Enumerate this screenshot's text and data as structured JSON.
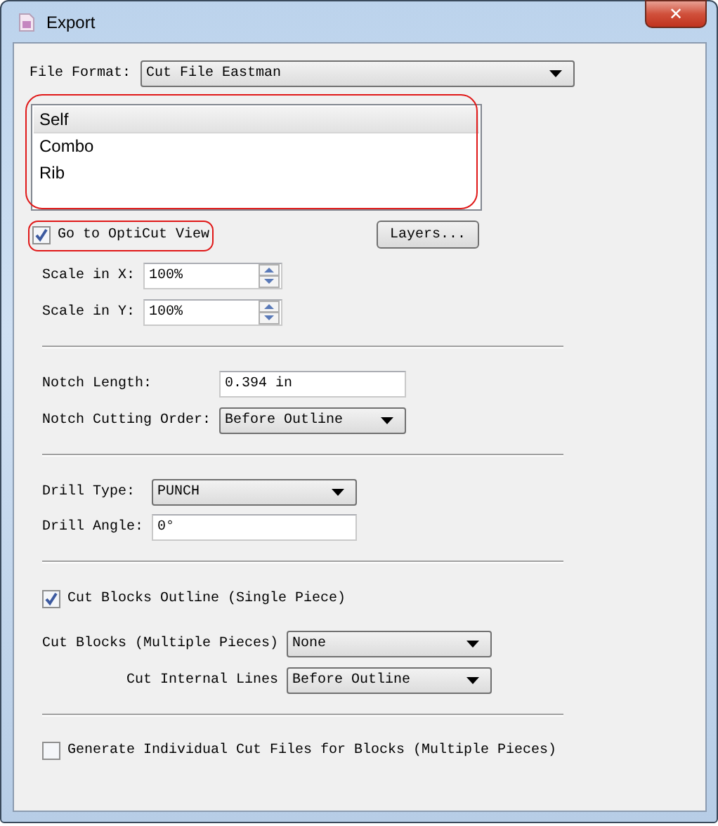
{
  "window": {
    "title": "Export",
    "close": "✕"
  },
  "file_format": {
    "label": "File Format:",
    "value": "Cut File Eastman"
  },
  "list_box": {
    "highlighted": true,
    "items": [
      {
        "label": "Self",
        "selected": true
      },
      {
        "label": "Combo",
        "selected": false
      },
      {
        "label": "Rib",
        "selected": false
      }
    ]
  },
  "go_to_opticut": {
    "label": "Go to OptiCut View",
    "checked": true,
    "highlighted": true
  },
  "layers_button": "Layers...",
  "scale": [
    {
      "label": "Scale in X:",
      "value": "100%"
    },
    {
      "label": "Scale in Y:",
      "value": "100%"
    }
  ],
  "notch_length": {
    "label": "Notch Length:",
    "value": "0.394 in"
  },
  "notch_cutting_order": {
    "label": "Notch Cutting Order:",
    "value": "Before Outline"
  },
  "drill_type": {
    "label": "Drill Type:",
    "value": "PUNCH"
  },
  "drill_angle": {
    "label": "Drill Angle:",
    "value": "0°"
  },
  "cut_blocks_outline": {
    "label": "Cut Blocks Outline (Single Piece)",
    "checked": true
  },
  "cut_blocks_multiple": {
    "label": "Cut Blocks (Multiple Pieces)",
    "value": "None"
  },
  "cut_internal_lines": {
    "label": "Cut Internal Lines",
    "value": "Before Outline"
  },
  "generate_individual": {
    "label": "Generate Individual Cut Files for Blocks (Multiple Pieces)",
    "checked": false
  }
}
